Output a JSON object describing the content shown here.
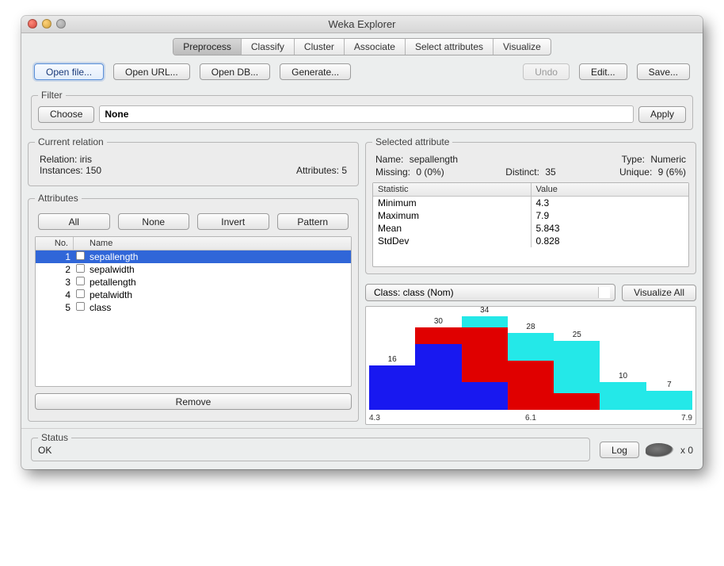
{
  "window": {
    "title": "Weka Explorer"
  },
  "tabs": [
    "Preprocess",
    "Classify",
    "Cluster",
    "Associate",
    "Select attributes",
    "Visualize"
  ],
  "active_tab": "Preprocess",
  "toolbar": {
    "open_file": "Open file...",
    "open_url": "Open URL...",
    "open_db": "Open DB...",
    "generate": "Generate...",
    "undo": "Undo",
    "edit": "Edit...",
    "save": "Save..."
  },
  "filter": {
    "legend": "Filter",
    "choose": "Choose",
    "value": "None",
    "apply": "Apply"
  },
  "relation": {
    "legend": "Current relation",
    "name_label": "Relation:",
    "name": "iris",
    "instances_label": "Instances:",
    "instances": "150",
    "attributes_label": "Attributes:",
    "attributes": "5"
  },
  "attributes_panel": {
    "legend": "Attributes",
    "all": "All",
    "none": "None",
    "invert": "Invert",
    "pattern": "Pattern",
    "head_no": "No.",
    "head_name": "Name",
    "rows": [
      {
        "no": "1",
        "name": "sepallength",
        "selected": true
      },
      {
        "no": "2",
        "name": "sepalwidth",
        "selected": false
      },
      {
        "no": "3",
        "name": "petallength",
        "selected": false
      },
      {
        "no": "4",
        "name": "petalwidth",
        "selected": false
      },
      {
        "no": "5",
        "name": "class",
        "selected": false
      }
    ],
    "remove": "Remove"
  },
  "selected_attr": {
    "legend": "Selected attribute",
    "name_label": "Name:",
    "name": "sepallength",
    "type_label": "Type:",
    "type": "Numeric",
    "missing_label": "Missing:",
    "missing": "0 (0%)",
    "distinct_label": "Distinct:",
    "distinct": "35",
    "unique_label": "Unique:",
    "unique": "9 (6%)",
    "stat_head_a": "Statistic",
    "stat_head_b": "Value",
    "stats": [
      {
        "k": "Minimum",
        "v": "4.3"
      },
      {
        "k": "Maximum",
        "v": "7.9"
      },
      {
        "k": "Mean",
        "v": "5.843"
      },
      {
        "k": "StdDev",
        "v": "0.828"
      }
    ]
  },
  "class_select": {
    "label": "Class: class (Nom)"
  },
  "visualize_all": "Visualize All",
  "chart_data": {
    "type": "bar",
    "title": "",
    "xlabel": "",
    "ylabel": "",
    "x_range": [
      4.3,
      7.9
    ],
    "axis_ticks": [
      "4.3",
      "6.1",
      "7.9"
    ],
    "bins": [
      {
        "total": 16,
        "segments": [
          {
            "color": "blue",
            "value": 16
          }
        ]
      },
      {
        "total": 30,
        "segments": [
          {
            "color": "blue",
            "value": 24
          },
          {
            "color": "red",
            "value": 6
          }
        ]
      },
      {
        "total": 34,
        "segments": [
          {
            "color": "blue",
            "value": 10
          },
          {
            "color": "red",
            "value": 20
          },
          {
            "color": "cyan",
            "value": 4
          }
        ]
      },
      {
        "total": 28,
        "segments": [
          {
            "color": "red",
            "value": 18
          },
          {
            "color": "cyan",
            "value": 10
          }
        ]
      },
      {
        "total": 25,
        "segments": [
          {
            "color": "red",
            "value": 6
          },
          {
            "color": "cyan",
            "value": 19
          }
        ]
      },
      {
        "total": 10,
        "segments": [
          {
            "color": "cyan",
            "value": 10
          }
        ]
      },
      {
        "total": 7,
        "segments": [
          {
            "color": "cyan",
            "value": 7
          }
        ]
      }
    ],
    "max_total": 34
  },
  "status": {
    "legend": "Status",
    "text": "OK",
    "log": "Log",
    "counter": "x 0"
  }
}
